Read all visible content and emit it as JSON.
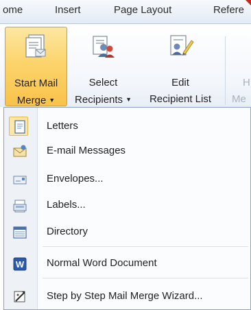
{
  "tabs": [
    "ome",
    "Insert",
    "Page Layout",
    "Refere"
  ],
  "ribbon": {
    "start_mail_merge": {
      "line1": "Start Mail",
      "line2": "Merge",
      "icon": "mail-merge-document-icon"
    },
    "select_recipients": {
      "line1": "Select",
      "line2": "Recipients",
      "icon": "recipients-icon"
    },
    "edit_recipient_list": {
      "line1": "Edit",
      "line2": "Recipient List",
      "icon": "edit-recipients-icon"
    },
    "clipped_button": {
      "line1": "H",
      "line2": "Me"
    }
  },
  "menu": {
    "items": [
      {
        "label": "Letters",
        "icon": "letter-icon"
      },
      {
        "label": "E-mail Messages",
        "icon": "email-envelope-icon"
      },
      {
        "label": "Envelopes...",
        "icon": "envelope-icon"
      },
      {
        "label": "Labels...",
        "icon": "labels-icon"
      },
      {
        "label": "Directory",
        "icon": "directory-icon"
      },
      {
        "label": "Normal Word Document",
        "icon": "word-document-icon"
      },
      {
        "label": "Step by Step Mail Merge Wizard...",
        "icon": "wizard-icon"
      }
    ]
  },
  "colors": {
    "active_button": "#fcd46c",
    "menu_highlight": "#fde7a8",
    "menu_border": "#8ea3c2"
  }
}
